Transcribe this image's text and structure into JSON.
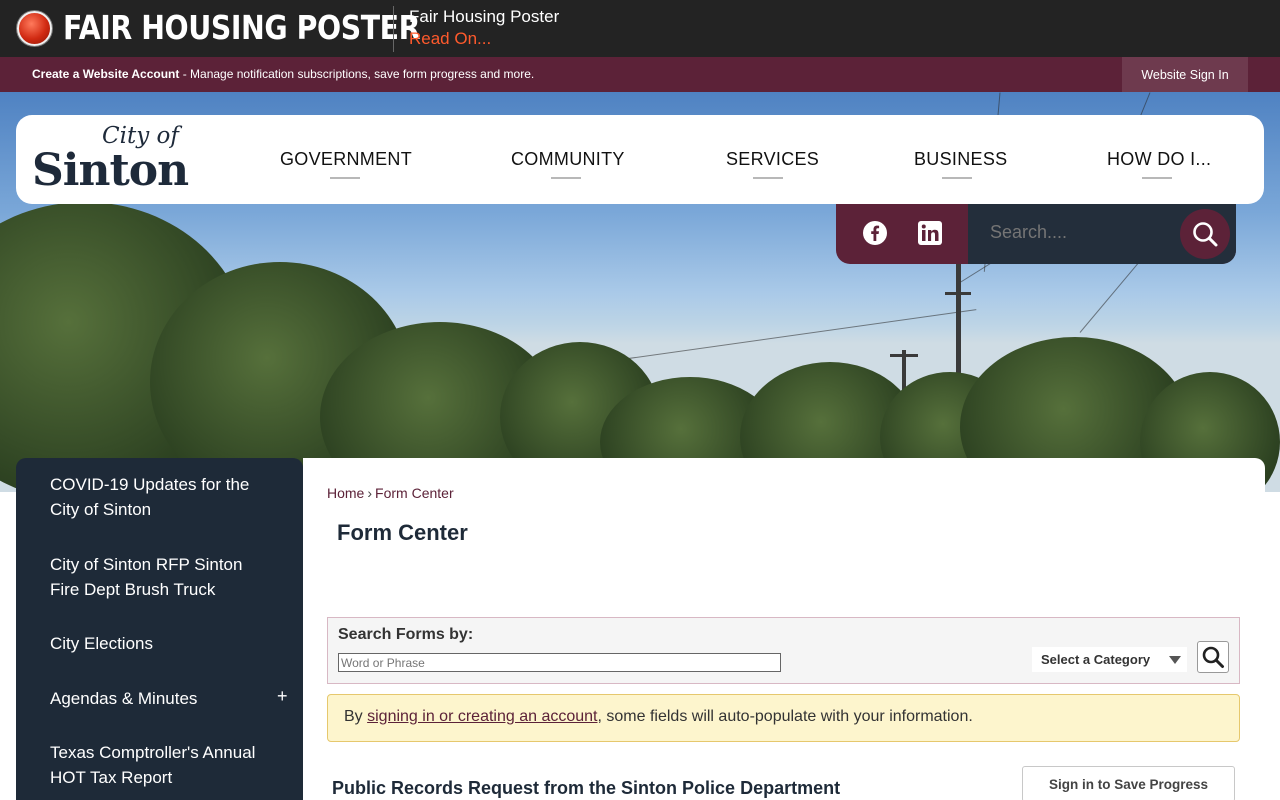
{
  "alert": {
    "title": "FAIR HOUSING POSTER",
    "item_title": "Fair Housing Poster",
    "read_on": "Read On..."
  },
  "account_bar": {
    "create_link": "Create a Website Account",
    "description": " - Manage notification subscriptions, save form progress and more.",
    "sign_in": "Website Sign In"
  },
  "logo": {
    "city_of": "City of",
    "name": "Sinton"
  },
  "nav": {
    "items": [
      "GOVERNMENT",
      "COMMUNITY",
      "SERVICES",
      "BUSINESS",
      "HOW DO I..."
    ]
  },
  "search": {
    "placeholder": "Search...."
  },
  "social": {
    "icons": [
      "facebook-icon",
      "linkedin-icon"
    ]
  },
  "sidebar": {
    "items": [
      "COVID-19 Updates for the City of Sinton",
      "City of Sinton RFP Sinton Fire Dept Brush Truck",
      "City Elections",
      "Agendas & Minutes",
      "Texas Comptroller's Annual HOT Tax Report"
    ],
    "expand_symbol": "+"
  },
  "breadcrumb": {
    "home": "Home",
    "separator": "›",
    "current": "Form Center"
  },
  "page_title": "Form Center",
  "search_forms": {
    "label": "Search Forms by:",
    "input_placeholder": "Word or Phrase",
    "category": "Select a Category"
  },
  "notice": {
    "prefix": "By ",
    "link": "signing in or creating an account",
    "suffix": ", some fields will auto-populate with your information."
  },
  "form": {
    "title": "Public Records Request from the Sinton Police Department",
    "save_button": "Sign in to Save Progress"
  },
  "colors": {
    "brand_maroon": "#5c2238",
    "navy": "#1e2a38",
    "alert_red": "#ff5a2c"
  }
}
